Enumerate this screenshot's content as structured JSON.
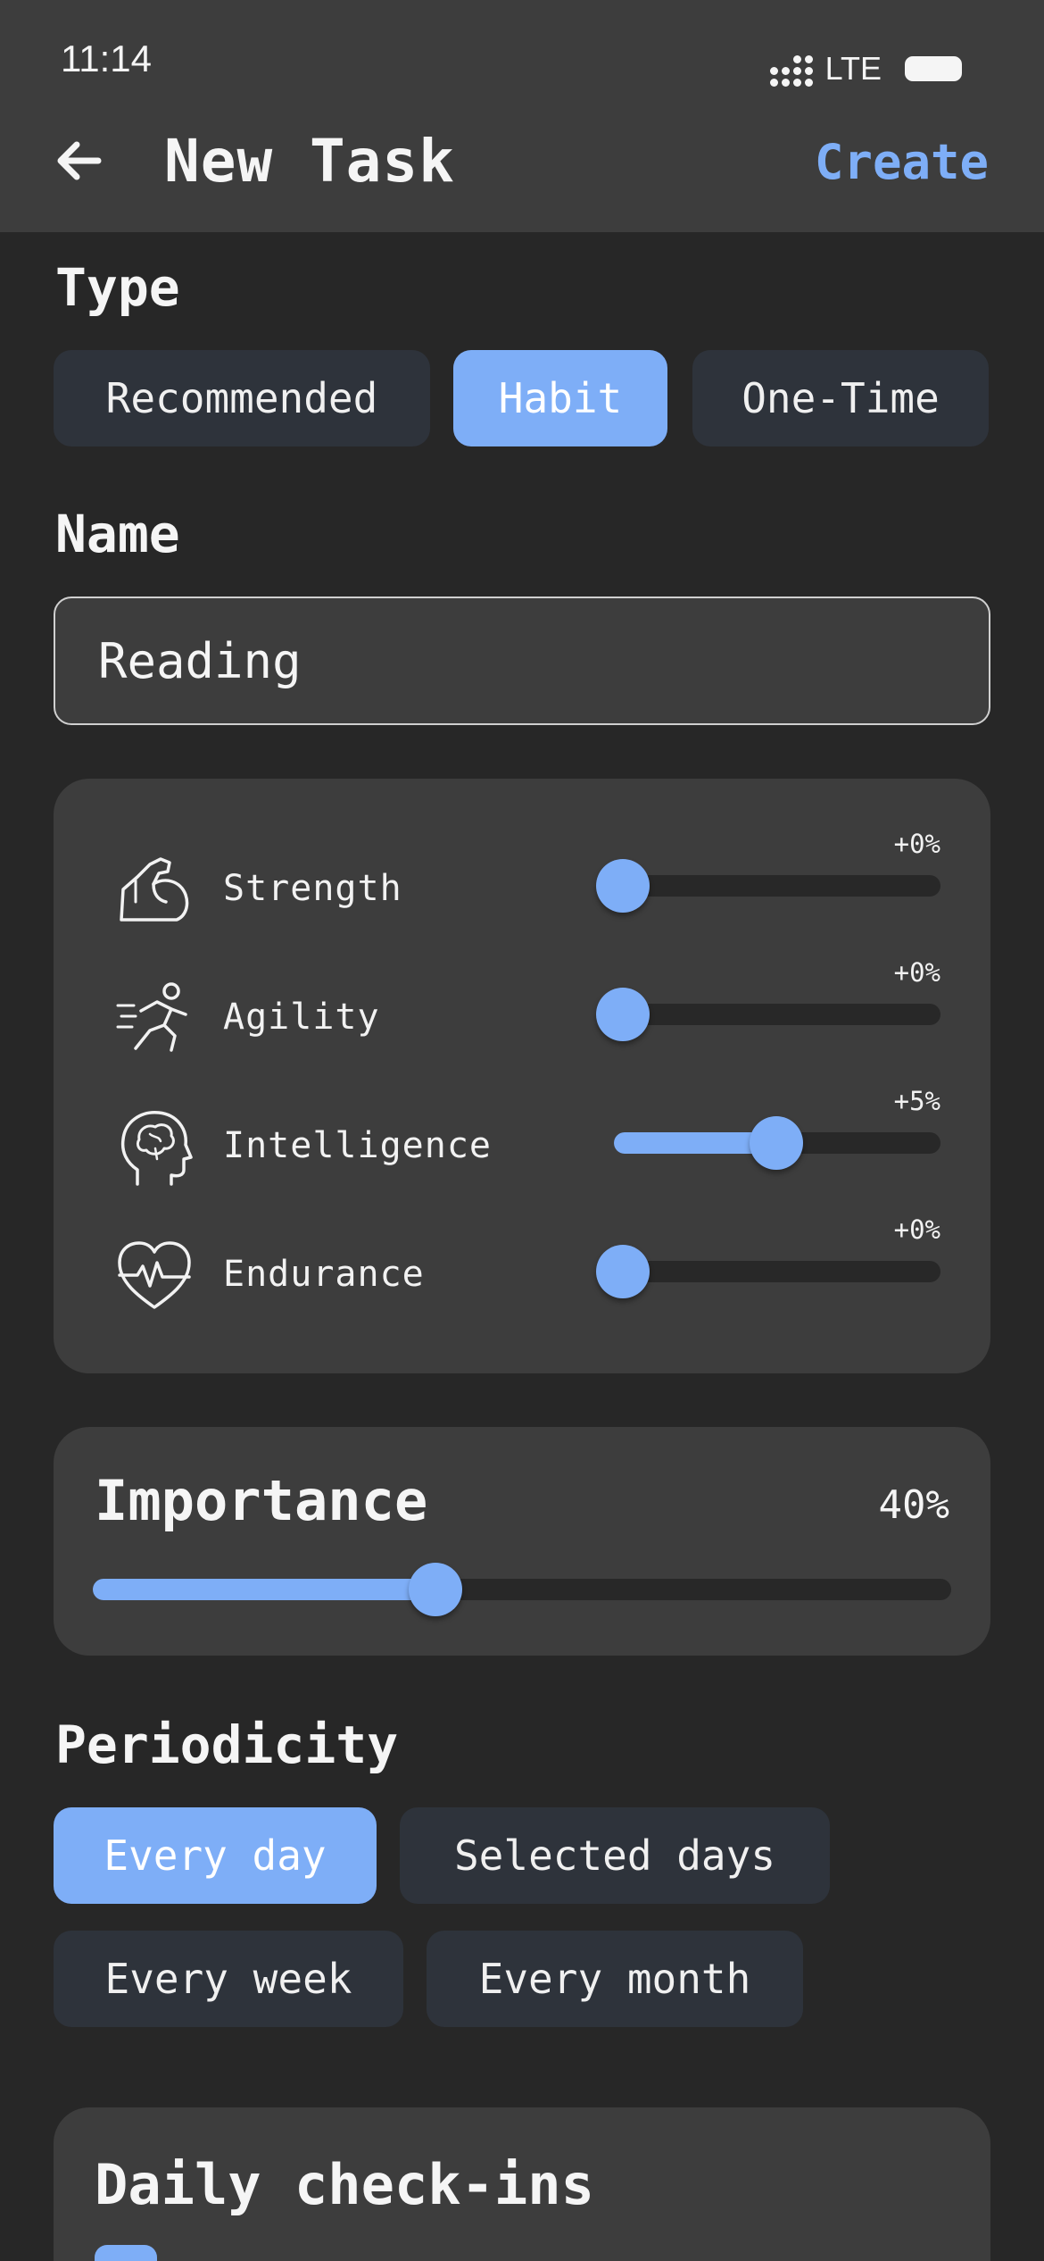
{
  "status_bar": {
    "time": "11:14",
    "network": "LTE"
  },
  "header": {
    "title": "New Task",
    "create_label": "Create",
    "back_icon": "arrow-left-icon"
  },
  "type_section": {
    "label": "Type",
    "options": [
      {
        "label": "Recommended",
        "selected": false
      },
      {
        "label": "Habit",
        "selected": true
      },
      {
        "label": "One-Time",
        "selected": false
      }
    ]
  },
  "name_section": {
    "label": "Name",
    "value": "Reading"
  },
  "stats": [
    {
      "label": "Strength",
      "percent_label": "+0%",
      "value": 0,
      "icon": "flexed-arm-icon"
    },
    {
      "label": "Agility",
      "percent_label": "+0%",
      "value": 0,
      "icon": "running-person-icon"
    },
    {
      "label": "Intelligence",
      "percent_label": "+5%",
      "value": 0.5,
      "icon": "brain-head-icon"
    },
    {
      "label": "Endurance",
      "percent_label": "+0%",
      "value": 0,
      "icon": "heart-pulse-icon"
    }
  ],
  "importance": {
    "label": "Importance",
    "percent_label": "40%",
    "value": 0.4
  },
  "periodicity": {
    "label": "Periodicity",
    "options": [
      {
        "label": "Every day",
        "selected": true
      },
      {
        "label": "Selected days",
        "selected": false
      },
      {
        "label": "Every week",
        "selected": false
      },
      {
        "label": "Every month",
        "selected": false
      }
    ]
  },
  "checkins": {
    "title": "Daily check-ins"
  },
  "colors": {
    "accent": "#7eaef7",
    "chip": "#2e333b",
    "card": "#3d3d3d",
    "background": "#272727"
  }
}
